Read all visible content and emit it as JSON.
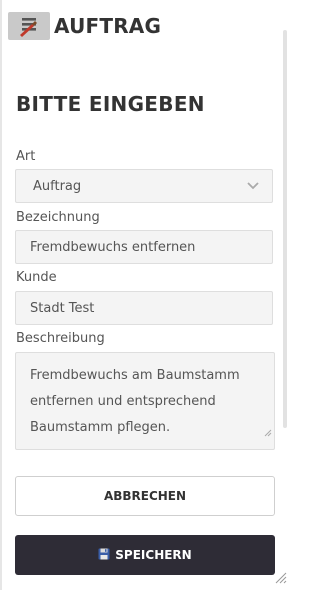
{
  "header": {
    "title": "AUFTRAG",
    "menu_icon": "menu-icon"
  },
  "section": {
    "title": "BITTE EINGEBEN"
  },
  "form": {
    "art": {
      "label": "Art",
      "value": "Auftrag"
    },
    "bezeichnung": {
      "label": "Bezeichnung",
      "value": "Fremdbewuchs entfernen"
    },
    "kunde": {
      "label": "Kunde",
      "value": "Stadt Test"
    },
    "beschreibung": {
      "label": "Beschreibung",
      "value": "Fremdbewuchs am Baumstamm entfernen und entsprechend Baumstamm pflegen."
    }
  },
  "buttons": {
    "cancel_label": "ABBRECHEN",
    "save_label": "SPEICHERN",
    "save_icon": "floppy-disk-icon"
  },
  "colors": {
    "primary_button": "#2e2c36",
    "field_bg": "#f4f4f4",
    "menu_button": "#c9c9c9"
  }
}
